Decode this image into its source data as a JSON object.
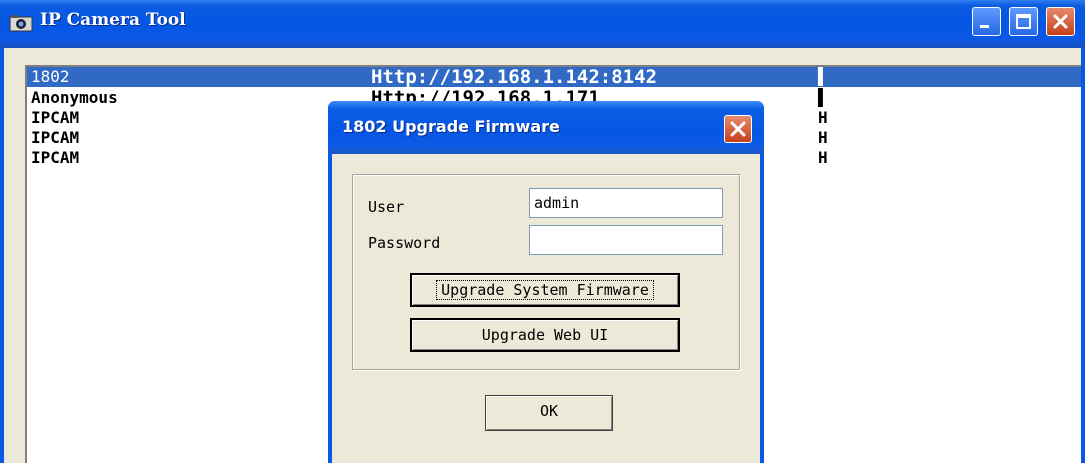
{
  "window": {
    "title": "IP Camera Tool",
    "accent": "#0a58e6",
    "selection_color": "#316ac5"
  },
  "camera_list": [
    {
      "name": "1802",
      "url": "Http://192.168.1.142:8142",
      "status": "▌",
      "selected": true
    },
    {
      "name": "Anonymous",
      "url": "Http://192.168.1.171",
      "status": "▌",
      "selected": false
    },
    {
      "name": "IPCAM",
      "url": "",
      "status": "H",
      "selected": false
    },
    {
      "name": "IPCAM",
      "url": "",
      "status": "H",
      "selected": false
    },
    {
      "name": "IPCAM",
      "url": "",
      "status": "H",
      "selected": false
    }
  ],
  "dialog": {
    "title": "1802 Upgrade Firmware",
    "user_label": "User",
    "user_value": "admin",
    "password_label": "Password",
    "password_value": "",
    "upgrade_firmware_label": "Upgrade System Firmware",
    "upgrade_webui_label": "Upgrade Web UI",
    "ok_label": "OK"
  }
}
